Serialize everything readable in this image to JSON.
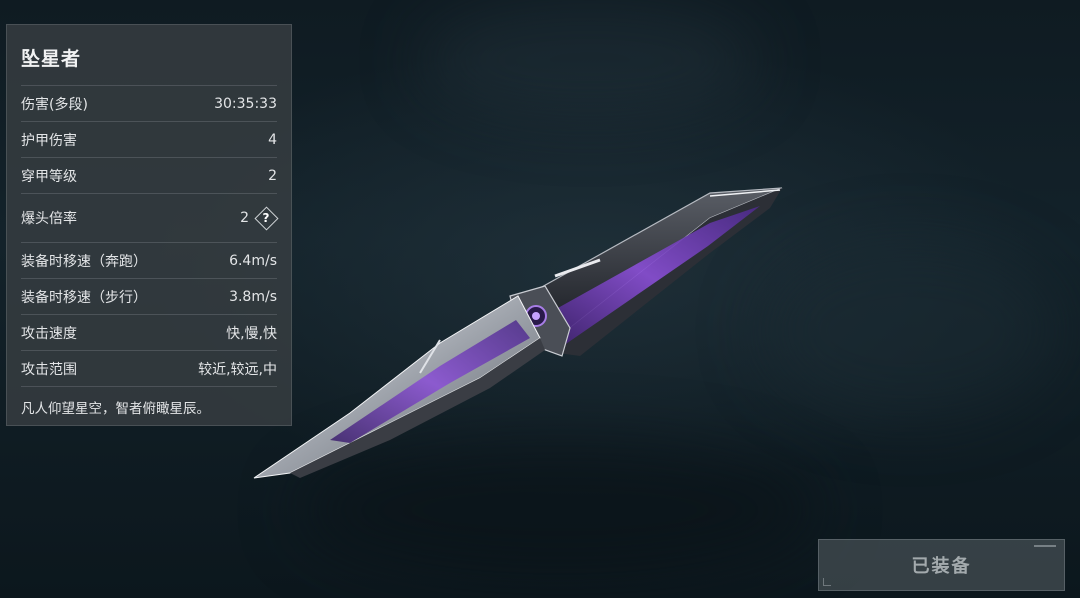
{
  "weapon": {
    "name": "坠星者",
    "description": "凡人仰望星空，智者俯瞰星辰。"
  },
  "stats": [
    {
      "label": "伤害(多段)",
      "value": "30:35:33"
    },
    {
      "label": "护甲伤害",
      "value": "4"
    },
    {
      "label": "穿甲等级",
      "value": "2"
    },
    {
      "label": "爆头倍率",
      "value": "2",
      "help": "?"
    },
    {
      "label": "装备时移速（奔跑）",
      "value": "6.4m/s"
    },
    {
      "label": "装备时移速（步行）",
      "value": "3.8m/s"
    },
    {
      "label": "攻击速度",
      "value": "快,慢,快"
    },
    {
      "label": "攻击范围",
      "value": "较近,较远,中"
    }
  ],
  "equip_button": {
    "label": "已装备",
    "state": "disabled"
  },
  "colors": {
    "background": "#0f1b22",
    "panel": "#383e42",
    "accent_purple": "#8a4fd6",
    "blade_silver": "#c9ccd2"
  },
  "icons": {
    "help": "help-diamond-icon"
  }
}
